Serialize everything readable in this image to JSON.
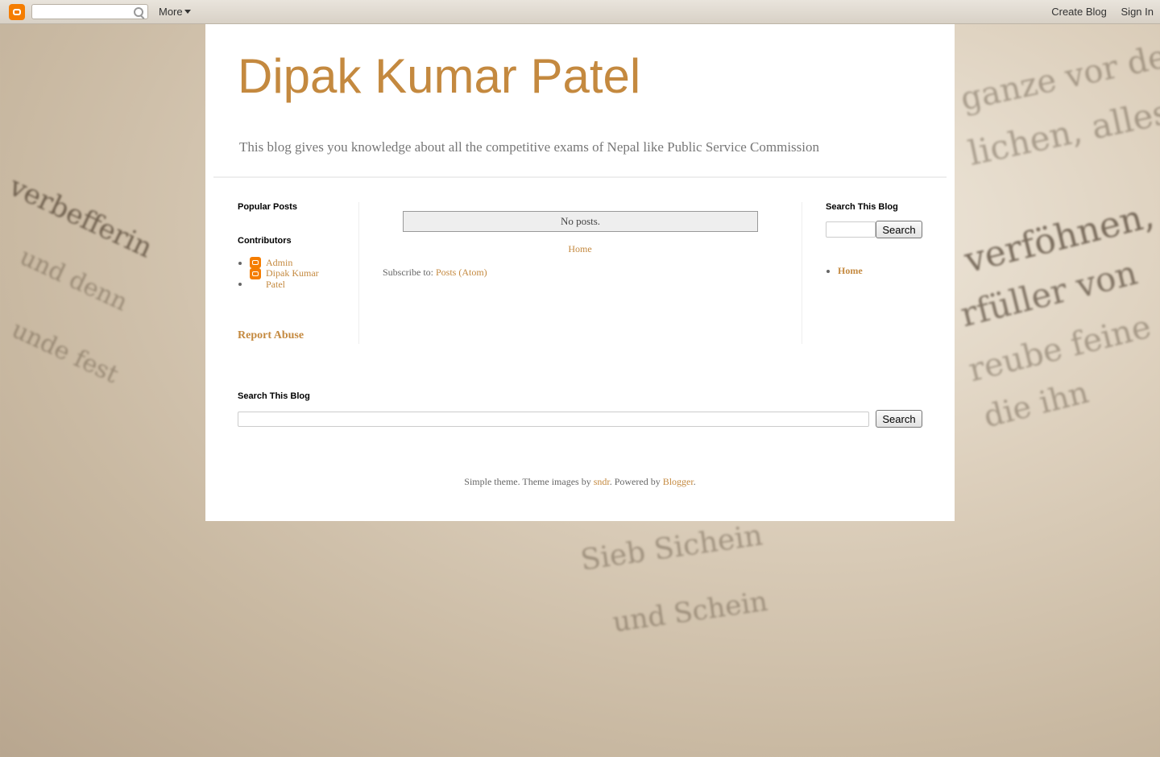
{
  "navbar": {
    "more_label": "More",
    "create_blog": "Create Blog",
    "sign_in": "Sign In"
  },
  "header": {
    "title": "Dipak Kumar Patel",
    "description": "This blog gives you knowledge about all the competitive exams of Nepal like Public Service Commission"
  },
  "left_sidebar": {
    "popular_posts_title": "Popular Posts",
    "contributors_title": "Contributors",
    "contributors": [
      "Admin",
      "Dipak Kumar Patel"
    ],
    "report_abuse": "Report Abuse"
  },
  "main": {
    "no_posts": "No posts.",
    "home_link": "Home",
    "subscribe_prefix": "Subscribe to:",
    "subscribe_link": "Posts (Atom)"
  },
  "right_sidebar": {
    "search_title": "Search This Blog",
    "search_button": "Search",
    "pages": [
      "Home"
    ]
  },
  "footer_search": {
    "title": "Search This Blog",
    "button": "Search"
  },
  "footer": {
    "prefix": "Simple theme. Theme images by",
    "author_link": "sndr",
    "middle": ". Powered by",
    "blogger_link": "Blogger",
    "suffix": "."
  },
  "colors": {
    "accent": "#c4893f",
    "blogger_orange": "#f57d00"
  }
}
